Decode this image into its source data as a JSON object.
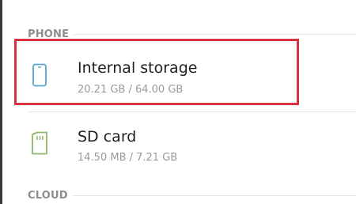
{
  "sections": {
    "phone": {
      "label": "PHONE"
    },
    "cloud": {
      "label": "CLOUD"
    }
  },
  "items": [
    {
      "icon": "phone-icon",
      "title": "Internal storage",
      "detail": "20.21 GB / 64.00 GB",
      "icon_color": "#5aa6cf",
      "highlighted": true
    },
    {
      "icon": "sd-card-icon",
      "title": "SD card",
      "detail": "14.50 MB / 7.21 GB",
      "icon_color": "#8fb66a",
      "highlighted": false
    }
  ],
  "colors": {
    "highlight": "#d9333f",
    "section_header": "#8e8e8e",
    "title": "#1f1f1f",
    "detail": "#9a9a9a"
  }
}
